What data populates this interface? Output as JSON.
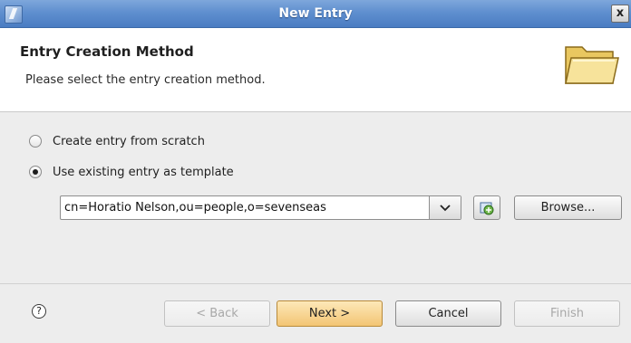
{
  "window": {
    "title": "New Entry",
    "close_label": "x"
  },
  "header": {
    "title": "Entry Creation Method",
    "description": "Please select the entry creation method.",
    "banner_icon": "folder-icon"
  },
  "options": [
    {
      "label": "Create entry from scratch",
      "selected": false
    },
    {
      "label": "Use existing entry as template",
      "selected": true
    }
  ],
  "template": {
    "value": "cn=Horatio Nelson,ou=people,o=sevenseas",
    "browse_label": "Browse..."
  },
  "footer": {
    "help_label": "?",
    "back_label": "< Back",
    "next_label": "Next >",
    "cancel_label": "Cancel",
    "finish_label": "Finish"
  }
}
